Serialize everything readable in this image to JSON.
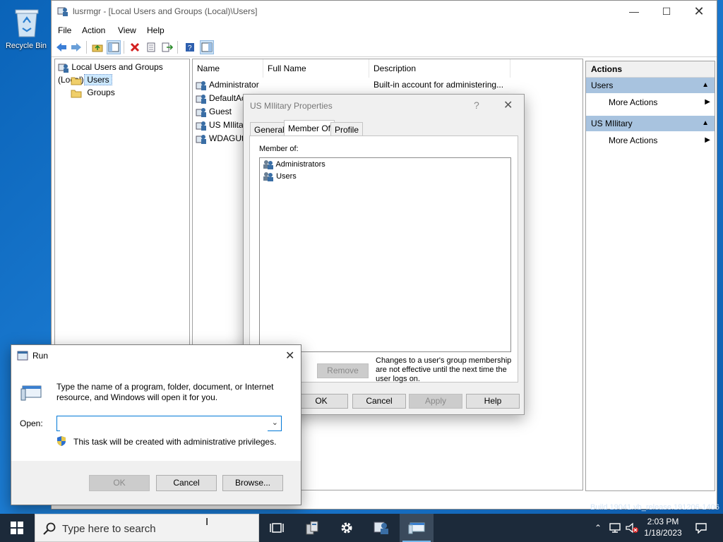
{
  "desktop": {
    "recycle_bin_label": "Recycle Bin",
    "build_watermark": "Build 19041.vb_release.191206-1406"
  },
  "mmc": {
    "title": "lusrmgr - [Local Users and Groups (Local)\\Users]",
    "menu": [
      "File",
      "Action",
      "View",
      "Help"
    ],
    "tree": {
      "root": "Local Users and Groups (Local)",
      "items": [
        "Users",
        "Groups"
      ],
      "selected": "Users"
    },
    "list": {
      "columns": [
        "Name",
        "Full Name",
        "Description"
      ],
      "rows": [
        {
          "name": "Administrator",
          "full_name": "",
          "description": "Built-in account for administering..."
        },
        {
          "name": "DefaultAc",
          "full_name": "",
          "description": ""
        },
        {
          "name": "Guest",
          "full_name": "",
          "description": ""
        },
        {
          "name": "US MIlitar",
          "full_name": "",
          "description": ""
        },
        {
          "name": "WDAGUti",
          "full_name": "",
          "description": ""
        }
      ]
    },
    "actions": {
      "header": "Actions",
      "groups": [
        {
          "name": "Users",
          "item": "More Actions"
        },
        {
          "name": "US MIlitary",
          "item": "More Actions"
        }
      ]
    }
  },
  "properties": {
    "title": "US MIlitary Properties",
    "help_glyph": "?",
    "tabs": [
      "General",
      "Member Of",
      "Profile"
    ],
    "active_tab": "Member Of",
    "member_of_label": "Member of:",
    "members": [
      "Administrators",
      "Users"
    ],
    "remove_label": "Remove",
    "note": "Changes to a user's group membership are not effective until the next time the user logs on.",
    "buttons": {
      "ok": "OK",
      "cancel": "Cancel",
      "apply": "Apply",
      "help": "Help"
    }
  },
  "run": {
    "title": "Run",
    "description": "Type the name of a program, folder, document, or Internet resource, and Windows will open it for you.",
    "open_label": "Open:",
    "open_value": "",
    "admin_note": "This task will be created with administrative privileges.",
    "buttons": {
      "ok": "OK",
      "cancel": "Cancel",
      "browse": "Browse..."
    }
  },
  "taskbar": {
    "search_placeholder": "Type here to search",
    "time": "2:03 PM",
    "date": "1/18/2023"
  }
}
